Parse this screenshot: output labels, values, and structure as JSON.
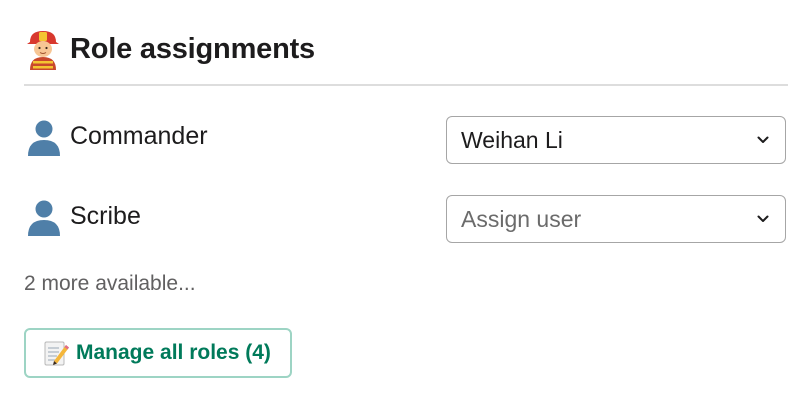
{
  "header": {
    "title": "Role assignments",
    "icon": "firefighter-icon"
  },
  "roles": [
    {
      "label": "Commander",
      "icon": "person-silhouette-icon",
      "select_value": "Weihan Li",
      "is_placeholder": false
    },
    {
      "label": "Scribe",
      "icon": "person-silhouette-icon",
      "select_value": "Assign user",
      "is_placeholder": true
    }
  ],
  "more_text": "2 more available...",
  "manage_button": {
    "label": "Manage all roles (4)",
    "icon": "memo-icon"
  },
  "colors": {
    "accent": "#007a5a",
    "button_border": "#9dd4c4",
    "divider": "#dddddd",
    "select_border": "#a6a6a6"
  }
}
